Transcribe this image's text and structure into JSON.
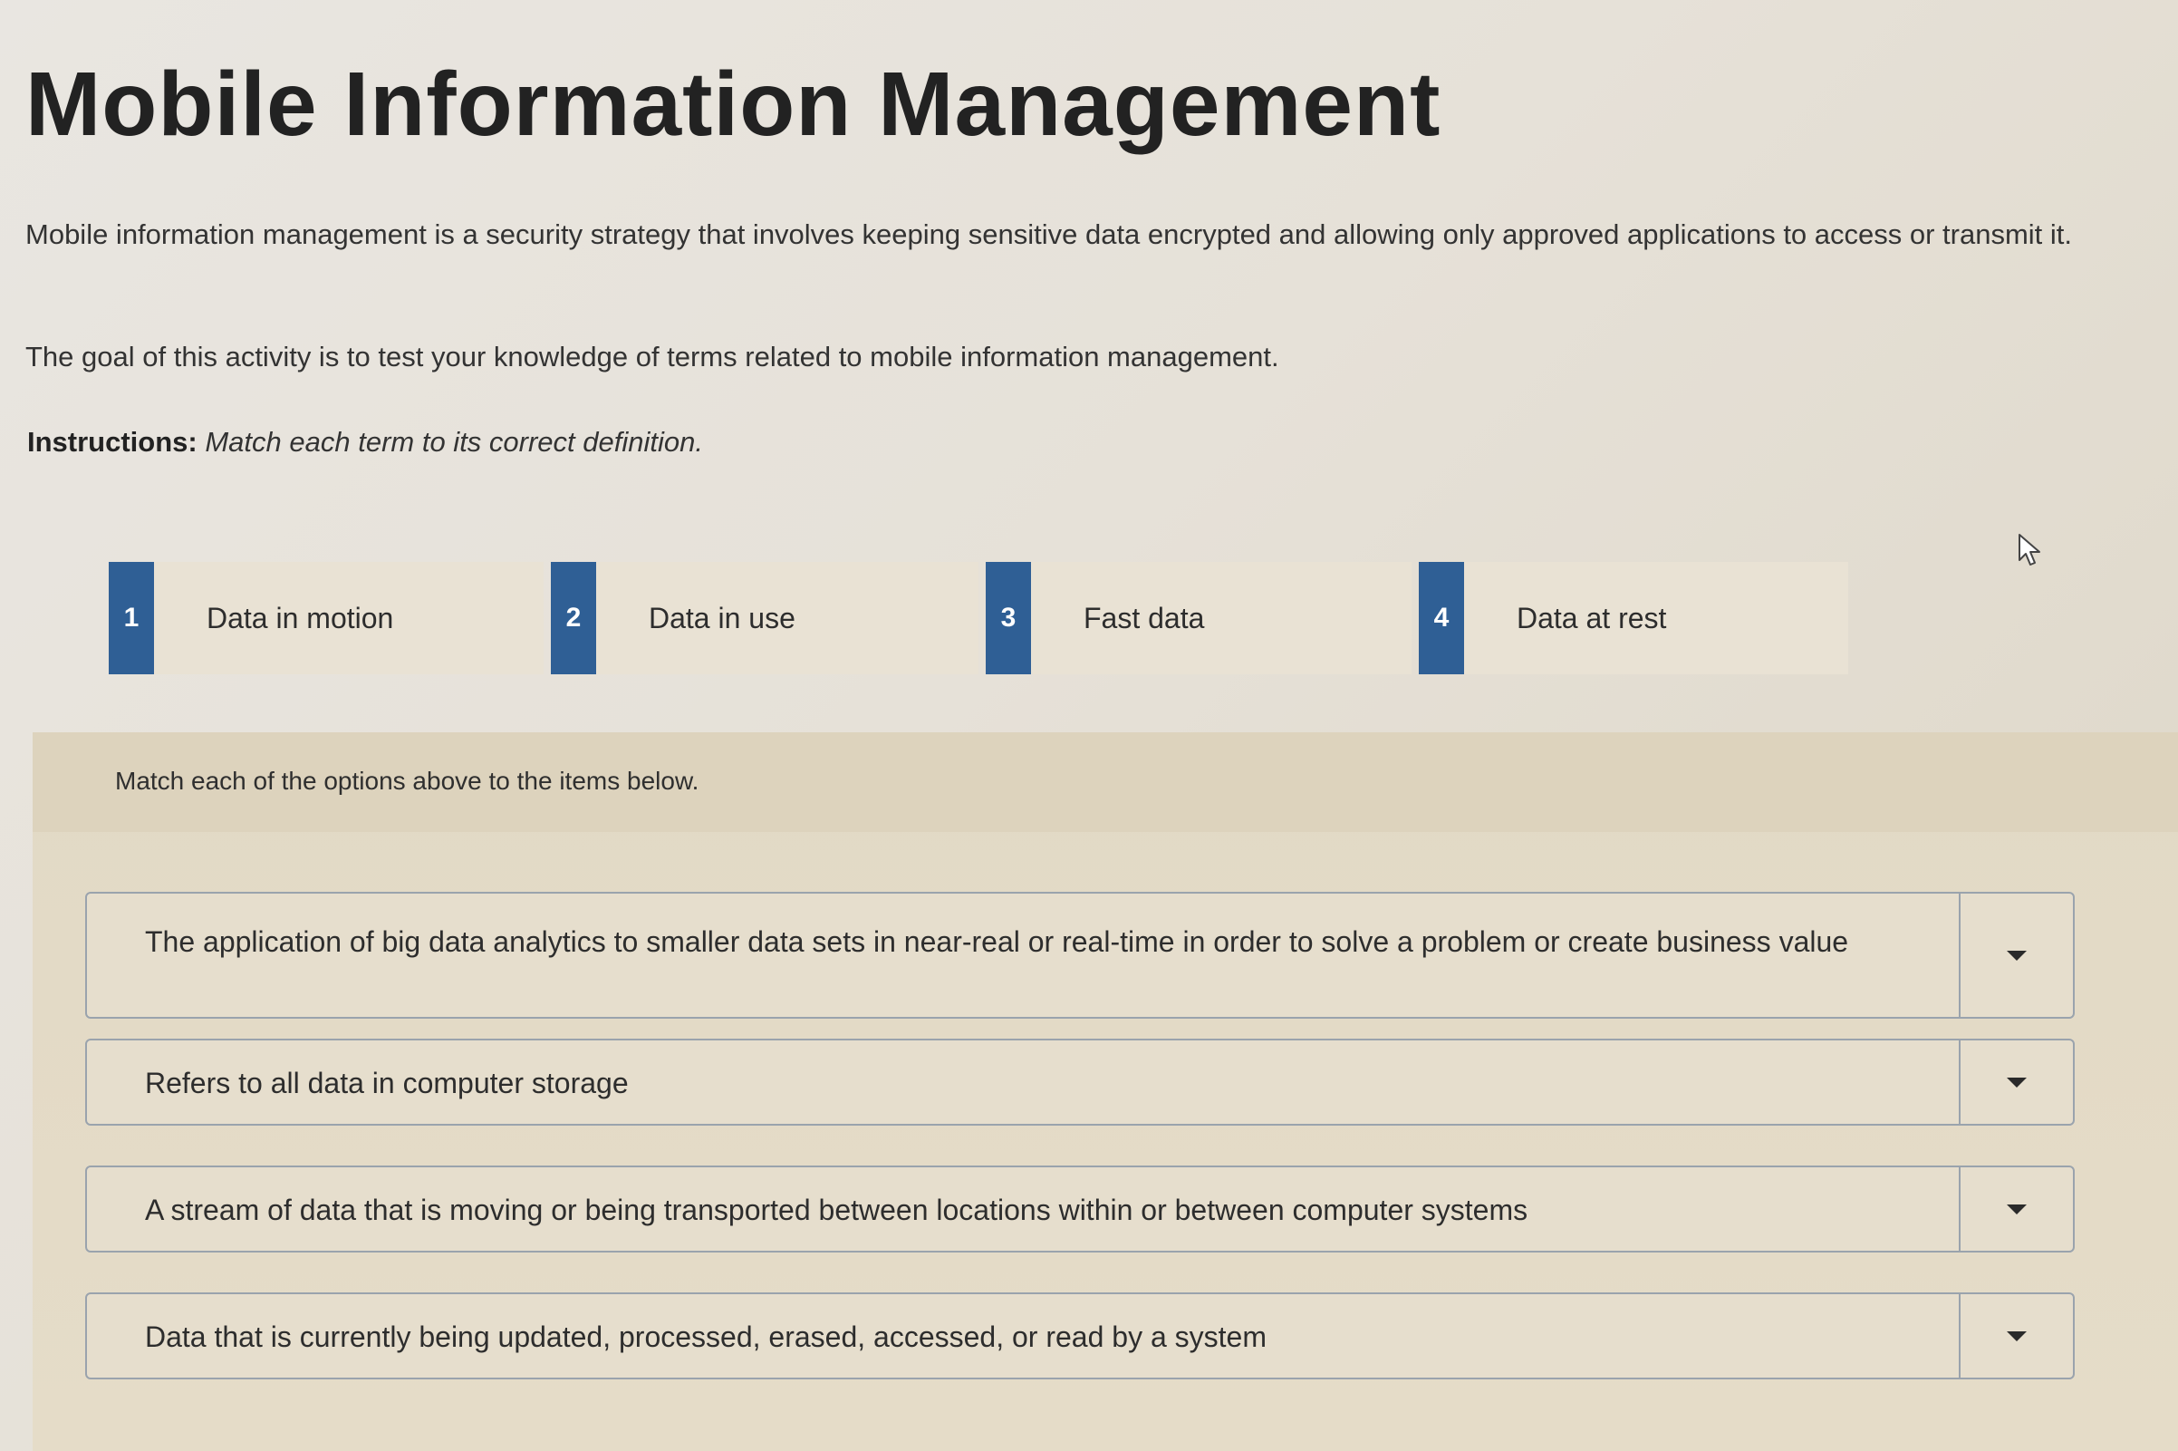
{
  "page": {
    "title": "Mobile Information Management",
    "intro": "Mobile information management is a security strategy that involves keeping sensitive data encrypted and allowing only approved applications to access or transmit it.",
    "goal": "The goal of this activity is to test your knowledge of terms related to mobile information management.",
    "instructions_label": "Instructions:",
    "instructions_text": "Match each term to its correct definition."
  },
  "options": [
    {
      "number": "1",
      "label": "Data in motion"
    },
    {
      "number": "2",
      "label": "Data in use"
    },
    {
      "number": "3",
      "label": "Fast data"
    },
    {
      "number": "4",
      "label": "Data at rest"
    }
  ],
  "matching": {
    "instruction": "Match each of the options above to the items below.",
    "items": [
      {
        "definition": "The application of big data analytics to smaller data sets in near-real or real-time in order to solve a problem or create business value"
      },
      {
        "definition": "Refers to all data in computer storage"
      },
      {
        "definition": "A stream of data that is moving or being transported between locations within or between computer systems"
      },
      {
        "definition": "Data that is currently being updated, processed, erased, accessed, or read by a system"
      }
    ]
  },
  "colors": {
    "badge_blue": "#2f5f95",
    "option_bg": "#e9e2d4",
    "match_area_bg": "#e2d9c5"
  },
  "icons": {
    "dropdown": "chevron-down-icon",
    "cursor": "mouse-pointer-icon"
  }
}
